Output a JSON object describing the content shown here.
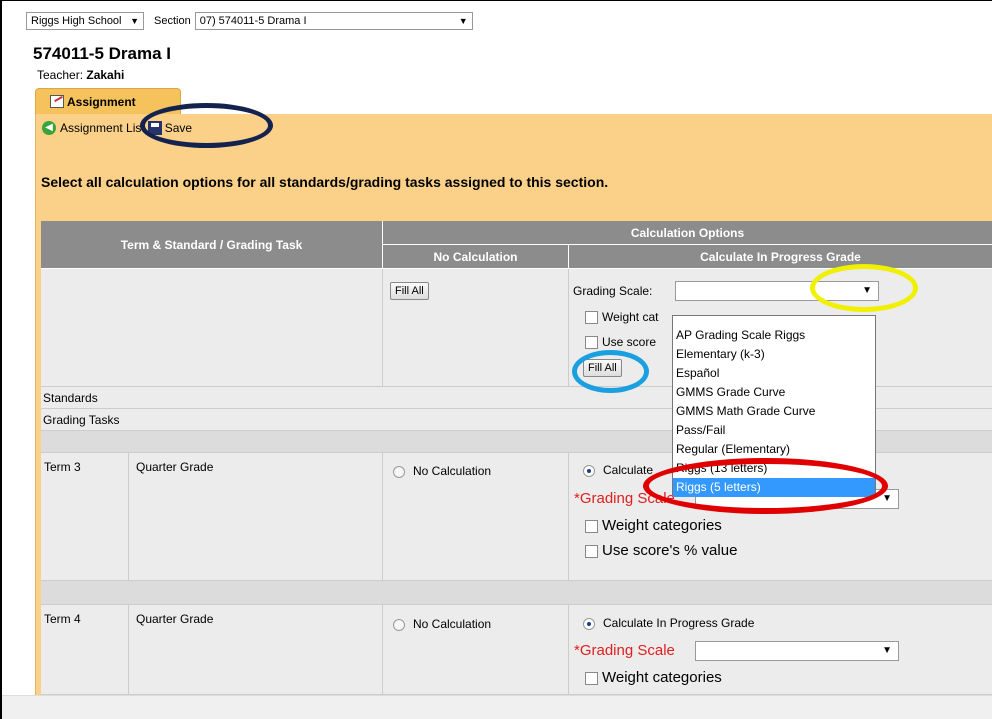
{
  "topbar": {
    "school": "Riggs High School",
    "section_label": "Section",
    "section_value": "07) 574011-5 Drama I"
  },
  "course": {
    "title": "574011-5 Drama I",
    "teacher_label": "Teacher:",
    "teacher_name": "Zakahi"
  },
  "tab": {
    "label": "Assignment"
  },
  "toolbar": {
    "list_label": "Assignment List",
    "save_label": "Save"
  },
  "instructions": "Select all calculation options for all standards/grading tasks assigned to this section.",
  "grid": {
    "headers": {
      "term_task": "Term & Standard / Grading Task",
      "calc_options": "Calculation Options",
      "no_calc": "No Calculation",
      "calc_progress": "Calculate In Progress Grade"
    },
    "fill_all": "Fill All",
    "grading_scale_label": "Grading Scale:",
    "weight_label_partial": "Weight cat",
    "use_score_partial": "Use score",
    "sections": {
      "standards": "Standards",
      "grading_tasks": "Grading Tasks"
    },
    "rows": [
      {
        "term": "Term 3",
        "task": "Quarter Grade",
        "no_calc": "No Calculation",
        "calc": "Calculate In Progress Grade",
        "calc_partial": "Calculate",
        "grading_scale": "*Grading Scale",
        "weight": "Weight categories",
        "use_score": "Use score's % value"
      },
      {
        "term": "Term 4",
        "task": "Quarter Grade",
        "no_calc": "No Calculation",
        "calc": "Calculate In Progress Grade",
        "grading_scale": "*Grading Scale",
        "weight": "Weight categories"
      }
    ]
  },
  "dropdown": {
    "options": [
      "AP Grading Scale Riggs",
      "Elementary (k-3)",
      "Español",
      "GMMS Grade Curve",
      "GMMS Math Grade Curve",
      "Pass/Fail",
      "Regular (Elementary)",
      "Riggs (13 letters)",
      "Riggs (5 letters)"
    ],
    "selected_index": 8
  },
  "colors": {
    "panel": "#fbd18a",
    "header": "#8c8c8c",
    "selected": "#3399ff",
    "annotation_navy": "#14224e",
    "annotation_yellow": "#f0f000",
    "annotation_cyan": "#1aa0e0",
    "annotation_red": "#e00000"
  }
}
